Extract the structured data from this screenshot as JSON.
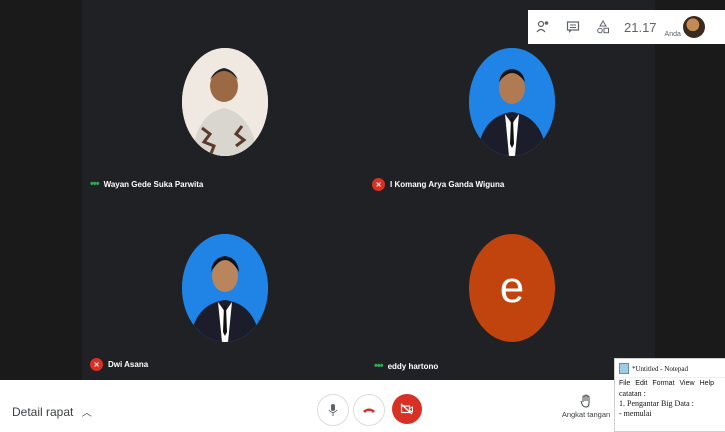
{
  "topbar": {
    "time": "21.17",
    "self_label": "Anda",
    "icons": [
      "people-icon",
      "chat-icon",
      "activities-icon"
    ]
  },
  "participants": [
    {
      "name": "Wayan Gede Suka Parwita",
      "status": "speaking"
    },
    {
      "name": "I Komang Arya Ganda Wiguna",
      "status": "muted"
    },
    {
      "name": "Dwi Asana",
      "status": "muted"
    },
    {
      "name": "eddy hartono",
      "status": "speaking",
      "initial": "e"
    }
  ],
  "bottom": {
    "details_label": "Detail rapat",
    "raise_hand_label": "Angkat tangan"
  },
  "notepad": {
    "title": "*Untitled - Notepad",
    "menu": [
      "File",
      "Edit",
      "Format",
      "View",
      "Help"
    ],
    "text": "catatan :\n1. Pengantar Big Data :\n- memulai"
  },
  "colors": {
    "stage": "#202124",
    "mute_red": "#d93025",
    "speaking_green": "#34a853",
    "avatar_e": "#c1440e"
  }
}
